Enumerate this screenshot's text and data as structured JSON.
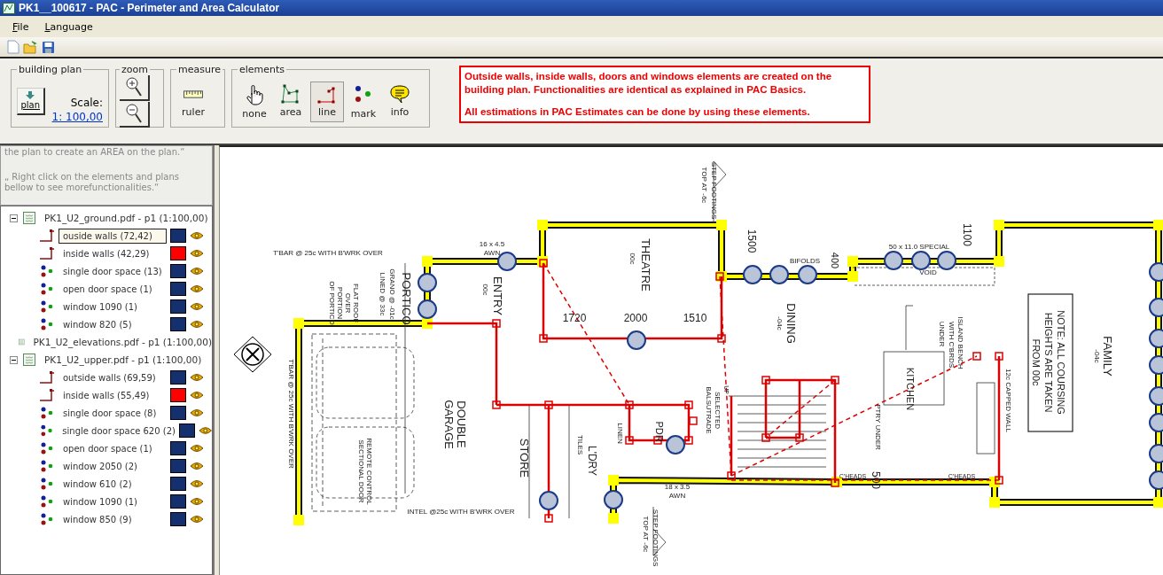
{
  "window": {
    "title": "PK1__100617 - PAC - Perimeter and Area Calculator"
  },
  "menu": [
    "File",
    "Language"
  ],
  "ribbon": {
    "building_plan": {
      "title": "building plan",
      "button": "plan",
      "scale_label": "Scale:",
      "scale_value": "1: 100,00"
    },
    "zoom": {
      "title": "zoom"
    },
    "measure": {
      "title": "measure",
      "tool": "ruler"
    },
    "elements": {
      "title": "elements",
      "tools": [
        {
          "label": "none",
          "kind": "hand",
          "selected": false
        },
        {
          "label": "area",
          "kind": "polygon",
          "selected": false
        },
        {
          "label": "line",
          "kind": "line",
          "selected": true
        },
        {
          "label": "mark",
          "kind": "dots",
          "selected": false
        },
        {
          "label": "info",
          "kind": "speech",
          "selected": false
        }
      ]
    },
    "info_box": [
      "Outside walls, inside walls, doors and windows elements are created on the building plan. Functionalities are identical as explained in PAC Basics.",
      "All estimations in PAC Estimates can be done by using these elements."
    ]
  },
  "help": [
    "the plan to create an AREA on the plan.“",
    "„ Right click on the elements and plans bellow to see morefunctionalities.“"
  ],
  "tree": [
    {
      "label": "PK1_U2_ground.pdf - p1 (1:100,00)",
      "children": [
        {
          "label": "ouside walls (72,42)",
          "kind": "line",
          "color": "#14306e",
          "selected": true
        },
        {
          "label": "inside walls (42,29)",
          "kind": "line",
          "color": "#ff0000",
          "selected": false
        },
        {
          "label": "single door space (13)",
          "kind": "mark",
          "color": "#14306e",
          "selected": false
        },
        {
          "label": "open door space (1)",
          "kind": "mark",
          "color": "#14306e",
          "selected": false
        },
        {
          "label": "window 1090 (1)",
          "kind": "mark",
          "color": "#14306e",
          "selected": false
        },
        {
          "label": "window 820 (5)",
          "kind": "mark",
          "color": "#14306e",
          "selected": false
        }
      ]
    },
    {
      "label": "PK1_U2_elevations.pdf - p1 (1:100,00)"
    },
    {
      "label": "PK1_U2_upper.pdf - p1 (1:100,00)",
      "children": [
        {
          "label": "outside walls (69,59)",
          "kind": "line",
          "color": "#14306e",
          "selected": false
        },
        {
          "label": "inside walls (55,49)",
          "kind": "line",
          "color": "#ff0000",
          "selected": false
        },
        {
          "label": "single door space (8)",
          "kind": "mark",
          "color": "#14306e",
          "selected": false
        },
        {
          "label": "single door space 620 (2)",
          "kind": "mark",
          "color": "#14306e",
          "selected": false
        },
        {
          "label": "open door space (1)",
          "kind": "mark",
          "color": "#14306e",
          "selected": false
        },
        {
          "label": "window 2050 (2)",
          "kind": "mark",
          "color": "#14306e",
          "selected": false
        },
        {
          "label": "window 610 (2)",
          "kind": "mark",
          "color": "#14306e",
          "selected": false
        },
        {
          "label": "window 1090 (1)",
          "kind": "mark",
          "color": "#14306e",
          "selected": false
        },
        {
          "label": "window 850 (9)",
          "kind": "mark",
          "color": "#14306e",
          "selected": false
        }
      ]
    }
  ],
  "plan_labels": [
    {
      "text": "T'BAR @ 25c WITH B'WRK OVER",
      "kind": "horizontal"
    },
    {
      "text": "16 x 4.5",
      "kind": "horizontal"
    },
    {
      "text": "AWN",
      "kind": "horizontal"
    },
    {
      "text": "PORTICO",
      "kind": "vertical"
    },
    {
      "text": "GRANO @ -01c",
      "kind": "vertical"
    },
    {
      "text": "LINED @ 33c",
      "kind": "vertical"
    },
    {
      "text": "FLAT ROOF",
      "kind": "vertical"
    },
    {
      "text": "OVER",
      "kind": "vertical"
    },
    {
      "text": "PORTION",
      "kind": "vertical"
    },
    {
      "text": "OF PORTICO",
      "kind": "vertical"
    },
    {
      "text": "ENTRY",
      "kind": "vertical"
    },
    {
      "text": "00c",
      "kind": "vertical"
    },
    {
      "text": "THEATRE",
      "kind": "vertical"
    },
    {
      "text": "00c",
      "kind": "vertical"
    },
    {
      "text": "1720",
      "kind": "horizontal"
    },
    {
      "text": "2000",
      "kind": "horizontal"
    },
    {
      "text": "1510",
      "kind": "horizontal"
    },
    {
      "text": "STEP FOOTINGS",
      "kind": "vertical"
    },
    {
      "text": "TOP AT -6c",
      "kind": "vertical"
    },
    {
      "text": "1500",
      "kind": "vertical"
    },
    {
      "text": "BIFOLDS",
      "kind": "horizontal"
    },
    {
      "text": "400",
      "kind": "vertical"
    },
    {
      "text": "50 x 11.0 SPECIAL",
      "kind": "horizontal"
    },
    {
      "text": "VOID",
      "kind": "horizontal"
    },
    {
      "text": "1100",
      "kind": "vertical"
    },
    {
      "text": "DINING",
      "kind": "vertical"
    },
    {
      "text": "-04c",
      "kind": "vertical"
    },
    {
      "text": "ISLAND BENCH",
      "kind": "vertical"
    },
    {
      "text": "WITH C'BRDS",
      "kind": "vertical"
    },
    {
      "text": "UNDER",
      "kind": "vertical"
    },
    {
      "text": "NOTE: ALL COURSING",
      "kind": "vertical"
    },
    {
      "text": "HEIGHTS ARE TAKEN",
      "kind": "vertical"
    },
    {
      "text": "FROM 00c",
      "kind": "vertical"
    },
    {
      "text": "FAMILY",
      "kind": "vertical"
    },
    {
      "text": "-04c",
      "kind": "vertical"
    },
    {
      "text": "KITCHEN",
      "kind": "vertical"
    },
    {
      "text": "SELECTED",
      "kind": "vertical"
    },
    {
      "text": "BALSUTRADE",
      "kind": "vertical"
    },
    {
      "text": "PTRY UNDER",
      "kind": "vertical"
    },
    {
      "text": "12c CAPPED WALL",
      "kind": "vertical"
    },
    {
      "text": "DOUBLE",
      "kind": "vertical"
    },
    {
      "text": "GARAGE",
      "kind": "vertical"
    },
    {
      "text": "REMOTE CONTROL",
      "kind": "vertical"
    },
    {
      "text": "SECTIONAL DOOR",
      "kind": "vertical"
    },
    {
      "text": "STORE",
      "kind": "vertical"
    },
    {
      "text": "L'DRY",
      "kind": "vertical"
    },
    {
      "text": "TILES",
      "kind": "vertical"
    },
    {
      "text": "LINEN",
      "kind": "vertical"
    },
    {
      "text": "PDR",
      "kind": "vertical"
    },
    {
      "text": "INTEL @25c WITH B'WRK OVER",
      "kind": "horizontal"
    },
    {
      "text": "18 x 3.5",
      "kind": "horizontal"
    },
    {
      "text": "AWN",
      "kind": "horizontal"
    },
    {
      "text": "STEP FOOTINGS",
      "kind": "vertical"
    },
    {
      "text": "TOP AT -6c",
      "kind": "vertical"
    },
    {
      "text": "T'BAR @ 25c WITH B'WRK OVER",
      "kind": "vertical"
    },
    {
      "text": "500",
      "kind": "vertical"
    },
    {
      "text": "C'HEADS",
      "kind": "horizontal"
    },
    {
      "text": "C'HEADS",
      "kind": "horizontal"
    },
    {
      "text": "UP",
      "kind": "vertical"
    }
  ]
}
